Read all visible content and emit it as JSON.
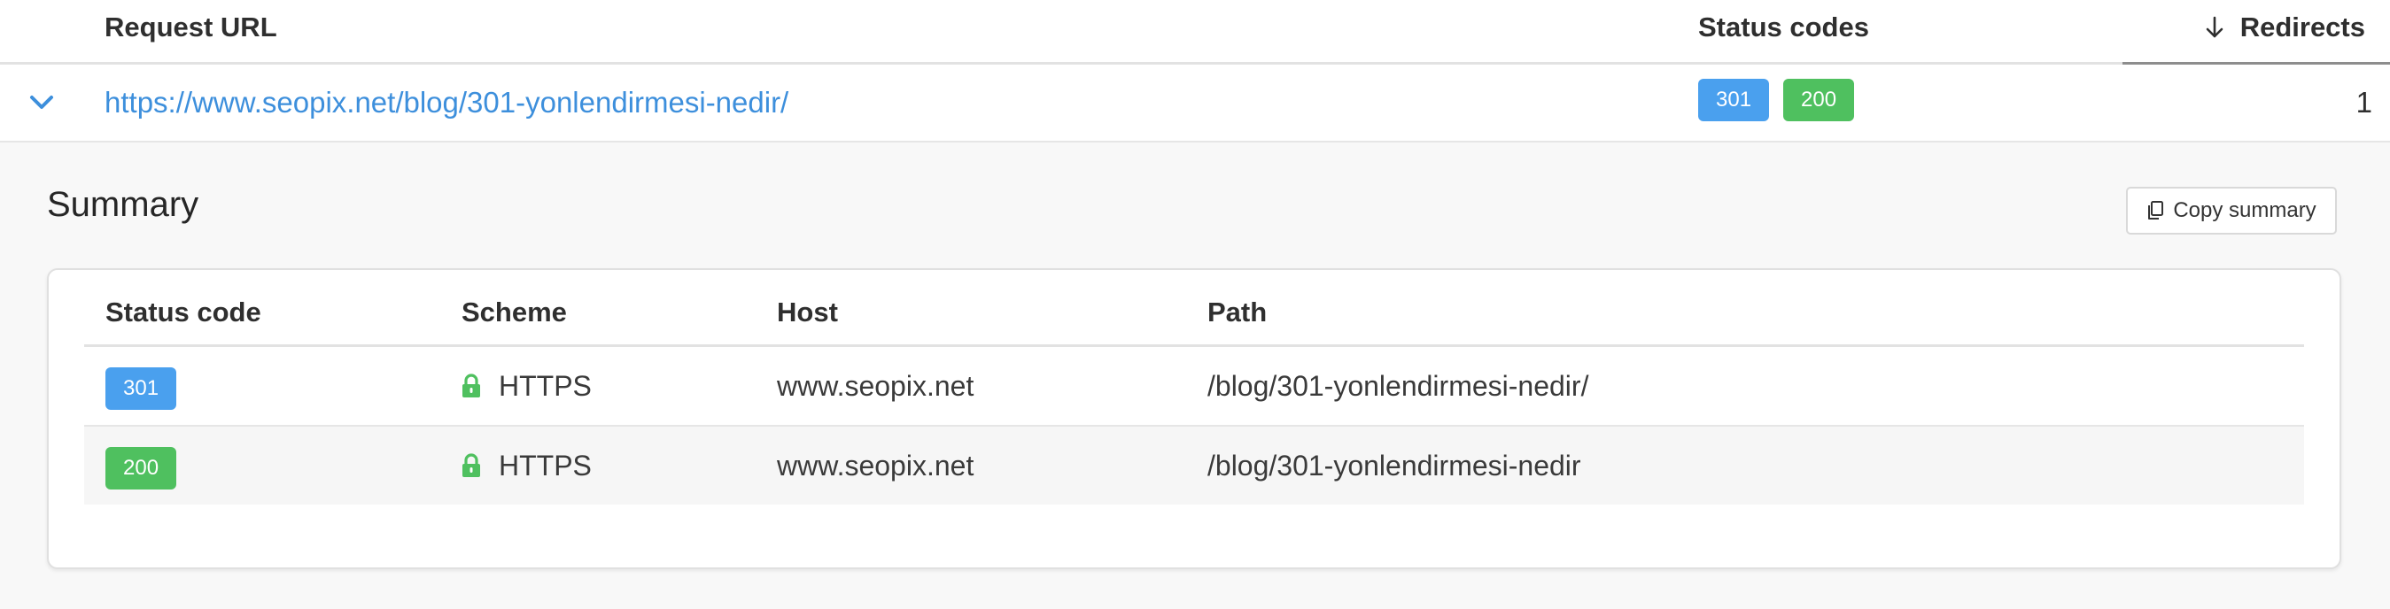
{
  "columns": {
    "request_url": "Request URL",
    "status_codes": "Status codes",
    "redirects": "Redirects"
  },
  "sort": {
    "column": "Redirects",
    "direction": "descending",
    "icon": "arrow-down-icon"
  },
  "result": {
    "url": "https://www.seopix.net/blog/301-yonlendirmesi-nedir/",
    "status_codes": [
      "301",
      "200"
    ],
    "redirects": "1",
    "expand_icon": "chevron-down-icon"
  },
  "summary": {
    "title": "Summary",
    "copy_label": "Copy summary",
    "copy_icon": "copy-icon",
    "headers": {
      "status_code": "Status code",
      "scheme": "Scheme",
      "host": "Host",
      "path": "Path"
    },
    "rows": [
      {
        "status": "301",
        "scheme": "HTTPS",
        "host": "www.seopix.net",
        "path": "/blog/301-yonlendirmesi-nedir/"
      },
      {
        "status": "200",
        "scheme": "HTTPS",
        "host": "www.seopix.net",
        "path": "/blog/301-yonlendirmesi-nedir"
      }
    ]
  },
  "colors": {
    "link": "#3d8fdc",
    "badge_301": "#4aa0ee",
    "badge_200": "#4fc05f",
    "lock": "#4fc05f"
  }
}
